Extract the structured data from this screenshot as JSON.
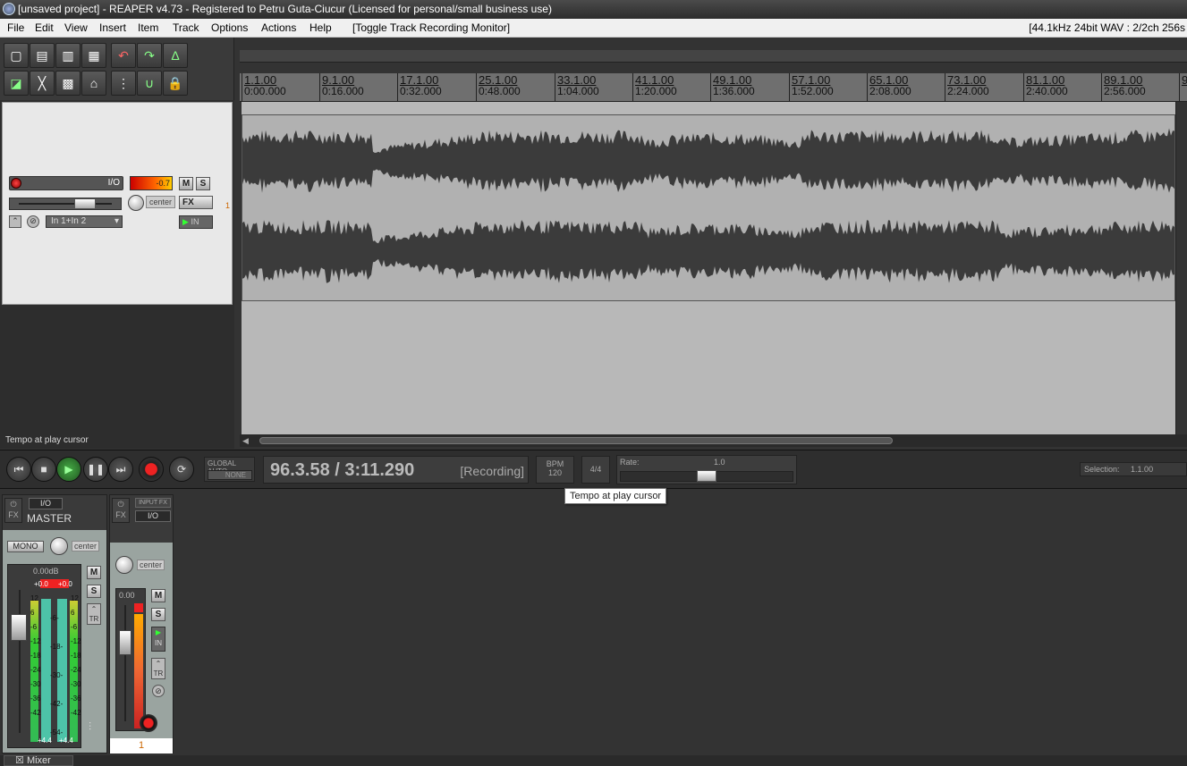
{
  "window": {
    "title": "[unsaved project] - REAPER v4.73 - Registered to Petru Guta-Ciucur (Licensed for personal/small business use)"
  },
  "menu": {
    "items": [
      "File",
      "Edit",
      "View",
      "Insert",
      "Item",
      "Track",
      "Options",
      "Actions",
      "Help"
    ],
    "toggle_monitor": "[Toggle Track Recording Monitor]",
    "status": "[44.1kHz 24bit WAV : 2/2ch 256s"
  },
  "track": {
    "io_label": "I/O",
    "meter_value": "-0.7",
    "mute": "M",
    "solo": "S",
    "fx": "FX",
    "pan": "center",
    "input": "In 1+In 2",
    "monitor": "IN",
    "number": "1"
  },
  "tempo_label": "Tempo at play cursor",
  "ruler": [
    {
      "bar": "1.1.00",
      "time": "0:00.000"
    },
    {
      "bar": "9.1.00",
      "time": "0:16.000"
    },
    {
      "bar": "17.1.00",
      "time": "0:32.000"
    },
    {
      "bar": "25.1.00",
      "time": "0:48.000"
    },
    {
      "bar": "33.1.00",
      "time": "1:04.000"
    },
    {
      "bar": "41.1.00",
      "time": "1:20.000"
    },
    {
      "bar": "49.1.00",
      "time": "1:36.000"
    },
    {
      "bar": "57.1.00",
      "time": "1:52.000"
    },
    {
      "bar": "65.1.00",
      "time": "2:08.000"
    },
    {
      "bar": "73.1.00",
      "time": "2:24.000"
    },
    {
      "bar": "81.1.00",
      "time": "2:40.000"
    },
    {
      "bar": "89.1.00",
      "time": "2:56.000"
    },
    {
      "bar": "9",
      "time": ""
    }
  ],
  "transport": {
    "global_auto": "GLOBAL AUTO",
    "none": "NONE",
    "position": "96.3.58 / 3:11.290",
    "state": "[Recording]",
    "bpm_label": "BPM",
    "bpm": "120",
    "timesig": "4/4",
    "rate_label": "Rate:",
    "rate": "1.0",
    "selection_label": "Selection:",
    "selection": "1.1.00"
  },
  "tooltip": "Tempo at play cursor",
  "master": {
    "io": "I/O",
    "fx": "FX",
    "name": "MASTER",
    "mono": "MONO",
    "pan": "center",
    "db": "0.00dB",
    "peak_l": "+0.0",
    "peak_r": "+0.0",
    "scale": [
      "12",
      "6",
      "-6",
      "-12",
      "-18",
      "-24",
      "-30",
      "-36",
      "-42"
    ],
    "inner_scale": [
      "-6-",
      "-18-",
      "-30-",
      "-42-",
      "-54-"
    ],
    "bottom_l": "+4.4",
    "bottom_r": "+4.4",
    "mute": "M",
    "solo": "S",
    "tr": "TR"
  },
  "track_strip": {
    "input_fx": "INPUT FX",
    "io": "I/O",
    "fx": "FX",
    "pan": "center",
    "db": "0.00",
    "mute": "M",
    "solo": "S",
    "in": "IN",
    "tr": "TR",
    "number": "1"
  },
  "mixer_tab": "Mixer"
}
